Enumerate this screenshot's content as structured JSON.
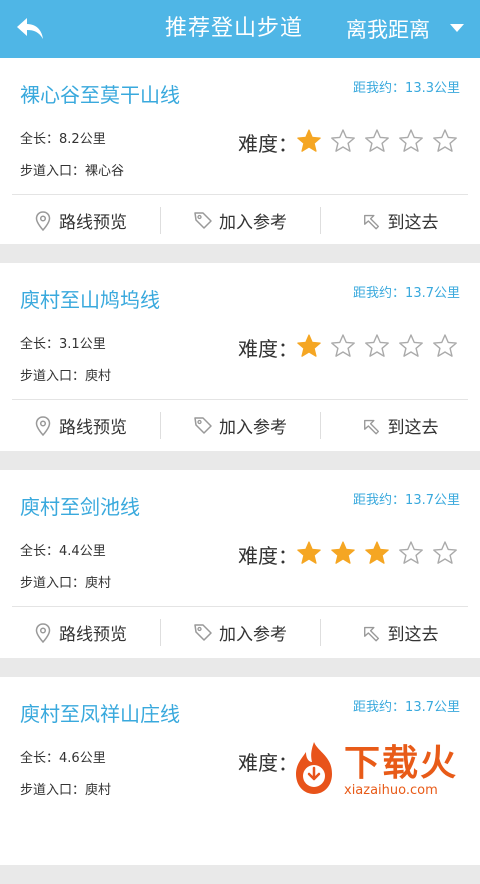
{
  "header": {
    "title": "推荐登山步道",
    "sort_label": "离我距离"
  },
  "labels": {
    "length_prefix": "全长：",
    "entry_prefix": "步道入口：",
    "difficulty": "难度：",
    "preview": "路线预览",
    "add_ref": "加入参考",
    "go_there": "到这去"
  },
  "trails": [
    {
      "name": "裸心谷至莫干山线",
      "distance": "距我约：13.3公里",
      "length": "8.2公里",
      "entry": "裸心谷",
      "difficulty": 1
    },
    {
      "name": "庾村至山鸠坞线",
      "distance": "距我约：13.7公里",
      "length": "3.1公里",
      "entry": "庾村",
      "difficulty": 1
    },
    {
      "name": "庾村至剑池线",
      "distance": "距我约：13.7公里",
      "length": "4.4公里",
      "entry": "庾村",
      "difficulty": 3
    },
    {
      "name": "庾村至凤祥山庄线",
      "distance": "距我约：13.7公里",
      "length": "4.6公里",
      "entry": "庾村",
      "difficulty": null
    }
  ],
  "watermark": {
    "brand": "下载火",
    "url": "xiazaihuo.com"
  },
  "colors": {
    "header": "#4fb6e6",
    "accent": "#39a9dd",
    "star_filled": "#f5a623",
    "star_empty": "#aaaaaa"
  }
}
